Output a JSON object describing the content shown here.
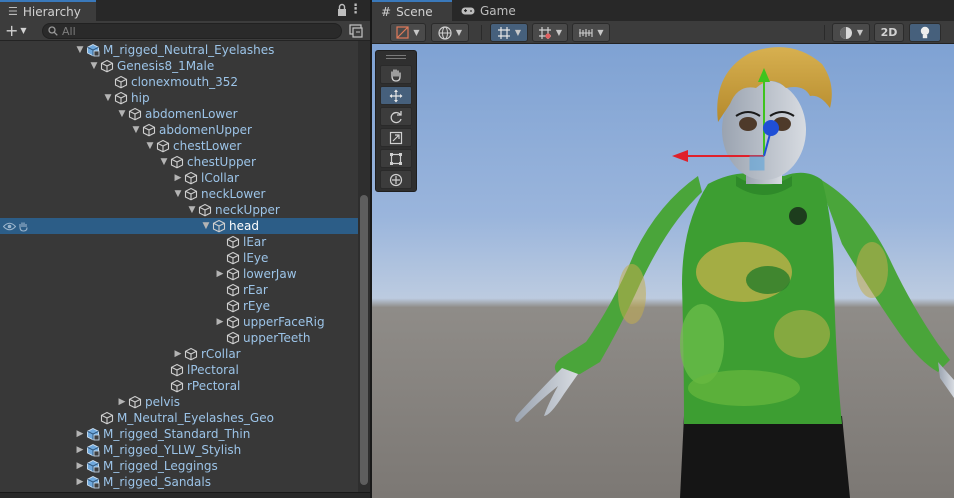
{
  "hierarchy": {
    "tab_label": "Hierarchy",
    "add_label": "+",
    "search_placeholder": "All",
    "tree": [
      {
        "label": "M_rigged_Neutral_Eyelashes",
        "depth": 5,
        "expander": "open",
        "icon": "prefab",
        "selected": false
      },
      {
        "label": "Genesis8_1Male",
        "depth": 6,
        "expander": "open",
        "icon": "cube",
        "selected": false
      },
      {
        "label": "clonexmouth_352",
        "depth": 7,
        "expander": "none",
        "icon": "cube",
        "selected": false
      },
      {
        "label": "hip",
        "depth": 7,
        "expander": "open",
        "icon": "cube",
        "selected": false
      },
      {
        "label": "abdomenLower",
        "depth": 8,
        "expander": "open",
        "icon": "cube",
        "selected": false
      },
      {
        "label": "abdomenUpper",
        "depth": 9,
        "expander": "open",
        "icon": "cube",
        "selected": false
      },
      {
        "label": "chestLower",
        "depth": 10,
        "expander": "open",
        "icon": "cube",
        "selected": false
      },
      {
        "label": "chestUpper",
        "depth": 11,
        "expander": "open",
        "icon": "cube",
        "selected": false
      },
      {
        "label": "lCollar",
        "depth": 12,
        "expander": "closed",
        "icon": "cube",
        "selected": false
      },
      {
        "label": "neckLower",
        "depth": 12,
        "expander": "open",
        "icon": "cube",
        "selected": false
      },
      {
        "label": "neckUpper",
        "depth": 13,
        "expander": "open",
        "icon": "cube",
        "selected": false
      },
      {
        "label": "head",
        "depth": 14,
        "expander": "open",
        "icon": "cube",
        "selected": true
      },
      {
        "label": "lEar",
        "depth": 15,
        "expander": "none",
        "icon": "cube",
        "selected": false
      },
      {
        "label": "lEye",
        "depth": 15,
        "expander": "none",
        "icon": "cube",
        "selected": false
      },
      {
        "label": "lowerJaw",
        "depth": 15,
        "expander": "closed",
        "icon": "cube",
        "selected": false
      },
      {
        "label": "rEar",
        "depth": 15,
        "expander": "none",
        "icon": "cube",
        "selected": false
      },
      {
        "label": "rEye",
        "depth": 15,
        "expander": "none",
        "icon": "cube",
        "selected": false
      },
      {
        "label": "upperFaceRig",
        "depth": 15,
        "expander": "closed",
        "icon": "cube",
        "selected": false
      },
      {
        "label": "upperTeeth",
        "depth": 15,
        "expander": "none",
        "icon": "cube",
        "selected": false
      },
      {
        "label": "rCollar",
        "depth": 12,
        "expander": "closed",
        "icon": "cube",
        "selected": false
      },
      {
        "label": "lPectoral",
        "depth": 11,
        "expander": "none",
        "icon": "cube",
        "selected": false
      },
      {
        "label": "rPectoral",
        "depth": 11,
        "expander": "none",
        "icon": "cube",
        "selected": false
      },
      {
        "label": "pelvis",
        "depth": 8,
        "expander": "closed",
        "icon": "cube",
        "selected": false
      },
      {
        "label": "M_Neutral_Eyelashes_Geo",
        "depth": 6,
        "expander": "none",
        "icon": "cube",
        "selected": false
      },
      {
        "label": "M_rigged_Standard_Thin",
        "depth": 5,
        "expander": "closed",
        "icon": "prefab",
        "selected": false
      },
      {
        "label": "M_rigged_YLLW_Stylish",
        "depth": 5,
        "expander": "closed",
        "icon": "prefab",
        "selected": false
      },
      {
        "label": "M_rigged_Leggings",
        "depth": 5,
        "expander": "closed",
        "icon": "prefab",
        "selected": false
      },
      {
        "label": "M_rigged_Sandals",
        "depth": 5,
        "expander": "closed",
        "icon": "prefab",
        "selected": false
      }
    ]
  },
  "scene": {
    "tabs": [
      {
        "label": "Scene",
        "icon": "hash-icon",
        "active": true
      },
      {
        "label": "Game",
        "icon": "gamepad-icon",
        "active": false
      }
    ],
    "toolbar": {
      "mode_2d_label": "2D"
    },
    "tools": [
      "hand-tool",
      "move-tool",
      "rotate-tool",
      "scale-tool",
      "rect-tool",
      "transform-tool"
    ],
    "active_tool": "move-tool"
  },
  "colors": {
    "accent": "#3a79bb",
    "selection": "#2c5d87",
    "link_text": "#9cc4e8",
    "gizmo_x": "#e0202a",
    "gizmo_y": "#3ec41e",
    "gizmo_z": "#1f4fd6"
  }
}
